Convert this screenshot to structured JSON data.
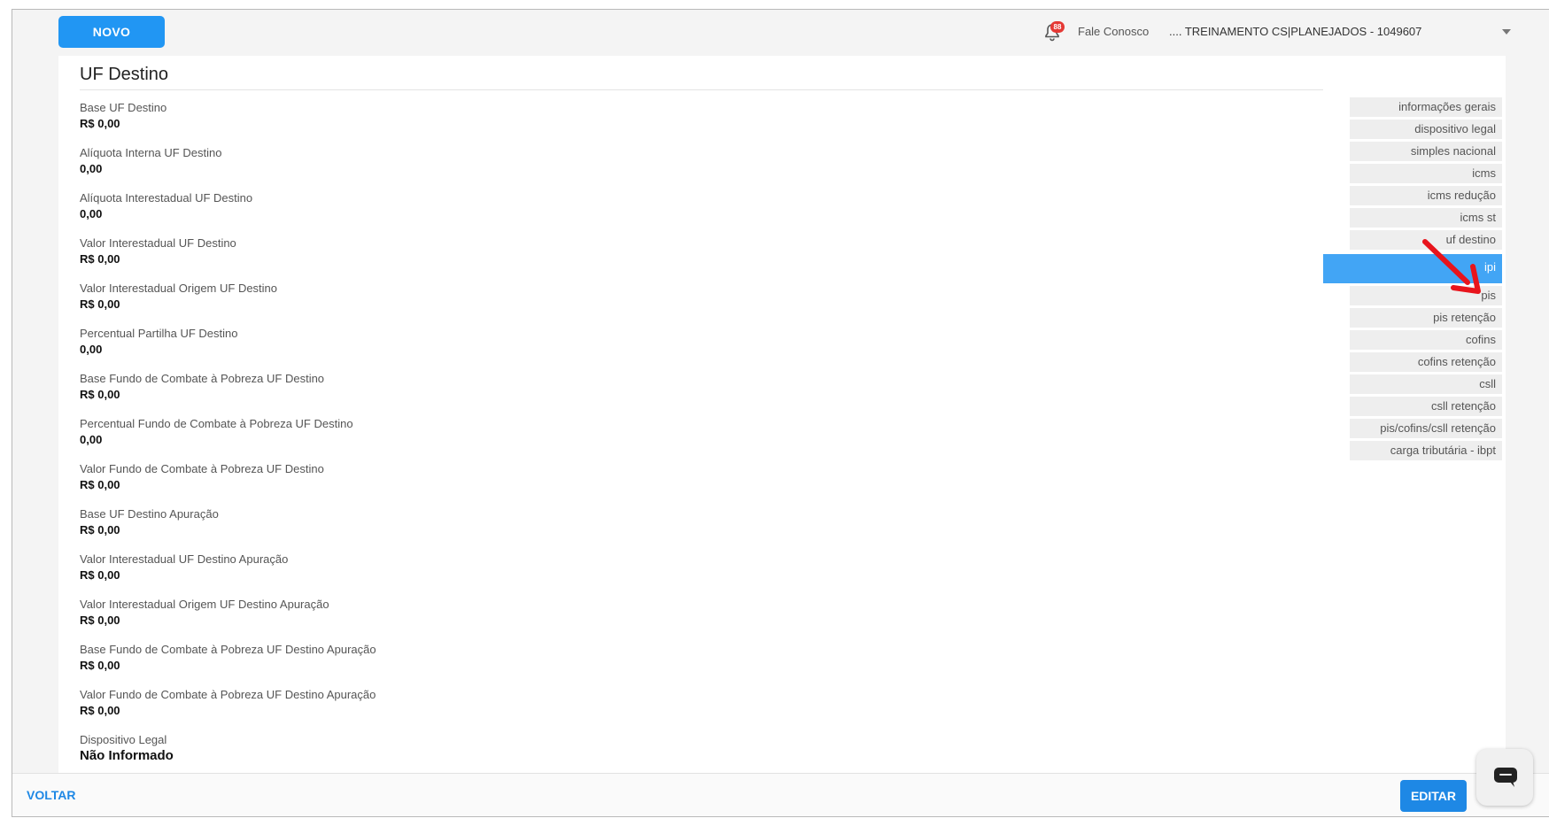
{
  "topbar": {
    "new_button": "NOVO",
    "notifications_count": "88",
    "contact_link": "Fale Conosco",
    "account": ".... TREINAMENTO CS|PLANEJADOS - 1049607"
  },
  "section": {
    "title": "UF Destino",
    "fields": [
      {
        "label": "Base UF Destino",
        "value": "R$ 0,00"
      },
      {
        "label": "Alíquota Interna UF Destino",
        "value": "0,00"
      },
      {
        "label": "Alíquota Interestadual UF Destino",
        "value": "0,00"
      },
      {
        "label": "Valor Interestadual UF Destino",
        "value": "R$ 0,00"
      },
      {
        "label": "Valor Interestadual Origem UF Destino",
        "value": "R$ 0,00"
      },
      {
        "label": "Percentual Partilha UF Destino",
        "value": "0,00"
      },
      {
        "label": "Base Fundo de Combate à Pobreza UF Destino",
        "value": "R$ 0,00"
      },
      {
        "label": "Percentual Fundo de Combate à Pobreza UF Destino",
        "value": "0,00"
      },
      {
        "label": "Valor Fundo de Combate à Pobreza UF Destino",
        "value": "R$ 0,00"
      },
      {
        "label": "Base UF Destino Apuração",
        "value": "R$ 0,00"
      },
      {
        "label": "Valor Interestadual UF Destino Apuração",
        "value": "R$ 0,00"
      },
      {
        "label": "Valor Interestadual Origem UF Destino Apuração",
        "value": "R$ 0,00"
      },
      {
        "label": "Base Fundo de Combate à Pobreza UF Destino Apuração",
        "value": "R$ 0,00"
      },
      {
        "label": "Valor Fundo de Combate à Pobreza UF Destino Apuração",
        "value": "R$ 0,00"
      },
      {
        "label": "Dispositivo Legal",
        "value": "Não Informado"
      }
    ]
  },
  "sidenav": {
    "items": [
      {
        "label": "informações gerais"
      },
      {
        "label": "dispositivo legal"
      },
      {
        "label": "simples nacional"
      },
      {
        "label": "icms"
      },
      {
        "label": "icms redução"
      },
      {
        "label": "icms st"
      },
      {
        "label": "uf destino"
      },
      {
        "label": "ipi",
        "active": true
      },
      {
        "label": "pis"
      },
      {
        "label": "pis retenção"
      },
      {
        "label": "cofins"
      },
      {
        "label": "cofins retenção"
      },
      {
        "label": "csll"
      },
      {
        "label": "csll retenção"
      },
      {
        "label": "pis/cofins/csll retenção"
      },
      {
        "label": "carga tributária - ibpt"
      }
    ]
  },
  "footer": {
    "back_button": "VOLTAR",
    "edit_button": "EDITAR"
  },
  "icons": {
    "bell": "bell-icon",
    "caret": "chevron-down-icon",
    "chat": "chat-icon",
    "arrow": "red-arrow-annotation"
  },
  "colors": {
    "primary": "#2196f3",
    "active_nav": "#42a5f5",
    "badge": "#e53935",
    "annotation": "#e8141c"
  }
}
